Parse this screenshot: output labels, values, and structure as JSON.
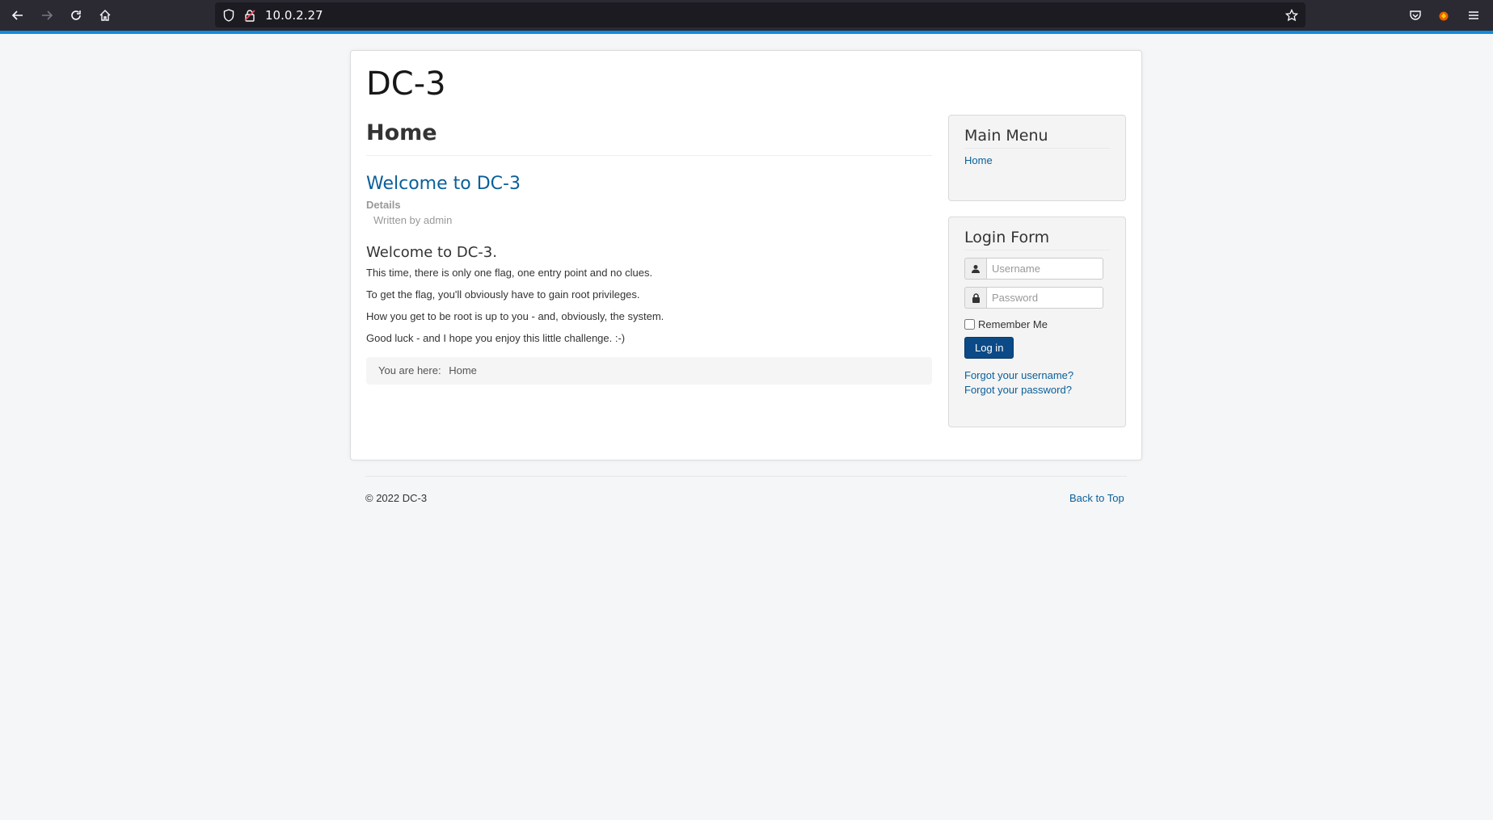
{
  "browser": {
    "url": "10.0.2.27"
  },
  "site": {
    "title": "DC-3"
  },
  "main": {
    "page_heading": "Home",
    "article_title": "Welcome to DC-3",
    "details_label": "Details",
    "written_by": "Written by admin",
    "content_heading": "Welcome to DC-3.",
    "paragraphs": [
      "This time, there is only one flag, one entry point and no clues.",
      "To get the flag, you'll obviously have to gain root privileges.",
      "How you get to be root is up to you - and, obviously, the system.",
      "Good luck - and I hope you enjoy this little challenge.  :-)"
    ],
    "breadcrumb_prefix": "You are here:",
    "breadcrumb_item": "Home"
  },
  "sidebar": {
    "main_menu": {
      "title": "Main Menu",
      "items": [
        "Home"
      ]
    },
    "login_form": {
      "title": "Login Form",
      "username_placeholder": "Username",
      "password_placeholder": "Password",
      "remember_label": "Remember Me",
      "login_button": "Log in",
      "forgot_username": "Forgot your username?",
      "forgot_password": "Forgot your password?"
    }
  },
  "footer": {
    "copyright": "© 2022 DC-3",
    "back_to_top": "Back to Top"
  },
  "colors": {
    "link": "#0a5f99",
    "button": "#0b4a86",
    "page_bg": "#f4f6f7",
    "toolbar_bg": "#2b2a33"
  }
}
